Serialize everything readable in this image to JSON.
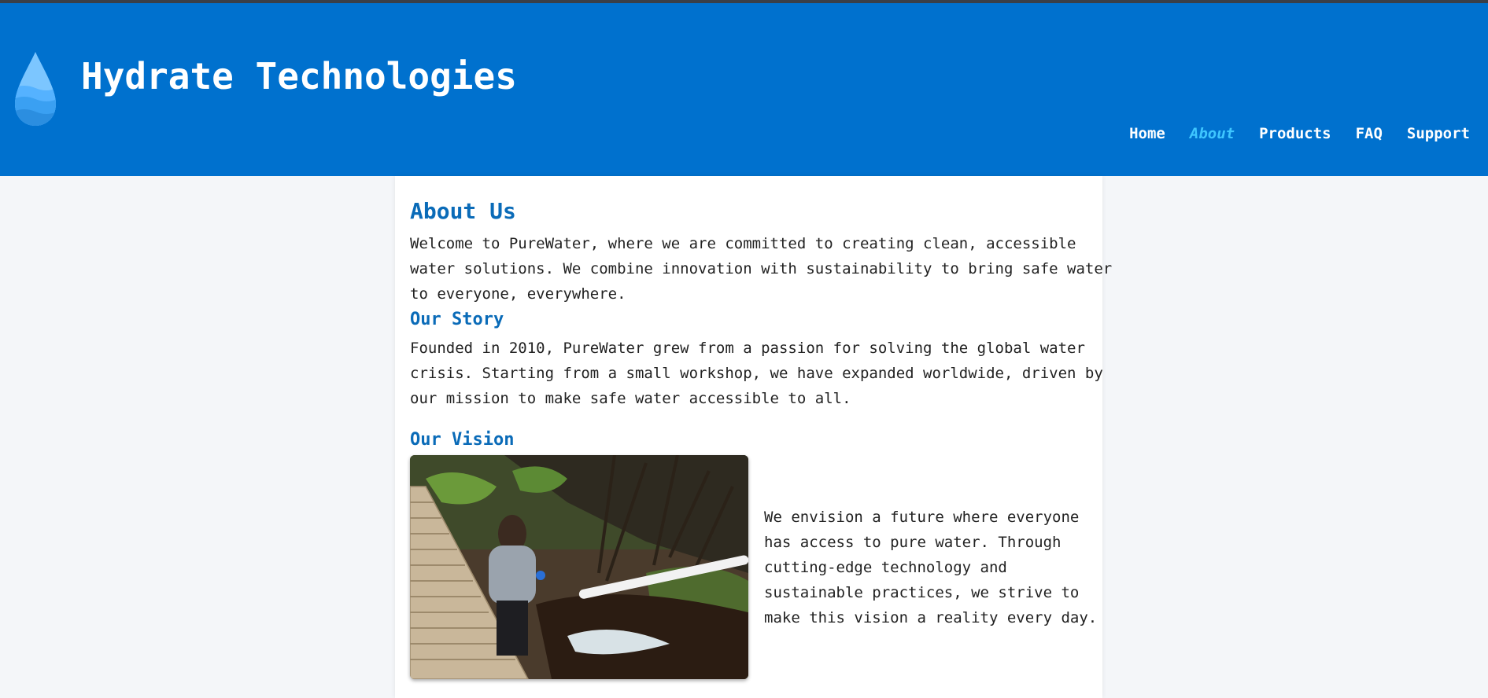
{
  "header": {
    "title": "Hydrate Technologies",
    "logo_icon": "water-drop-icon",
    "brand_color": "#0071ce"
  },
  "nav": {
    "items": [
      {
        "label": "Home",
        "active": false
      },
      {
        "label": "About",
        "active": true
      },
      {
        "label": "Products",
        "active": false
      },
      {
        "label": "FAQ",
        "active": false
      },
      {
        "label": "Support",
        "active": false
      }
    ]
  },
  "main": {
    "heading": "About Us",
    "intro_lines": [
      "Welcome to PureWater, where we are committed to creating clean, accessible",
      "water solutions. We combine innovation with sustainability to bring safe water",
      "to everyone, everywhere."
    ],
    "story": {
      "heading": "Our Story",
      "lines": [
        "Founded in 2010, PureWater grew from a passion for solving the global water",
        "crisis. Starting from a small workshop, we have expanded worldwide, driven by",
        "our mission to make safe water accessible to all."
      ]
    },
    "vision": {
      "heading": "Our Vision",
      "lines": [
        "We envision a future where everyone",
        "has access to pure water. Through",
        "cutting-edge technology and",
        "sustainable practices, we strive to",
        "make this vision a reality every day."
      ]
    }
  }
}
